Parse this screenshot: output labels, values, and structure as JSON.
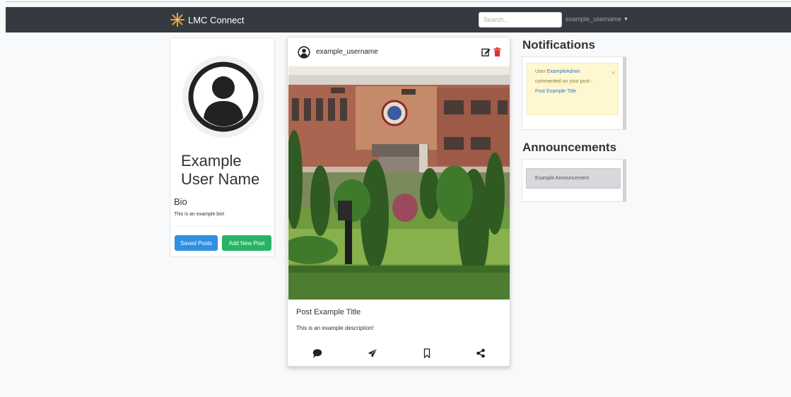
{
  "app": {
    "brand_name": "LMC Connect",
    "brand_color": "#e8a33a"
  },
  "header": {
    "search_placeholder": "Search...",
    "username": "example_username",
    "caret": "▼",
    "bg_color": "#343a40"
  },
  "profile": {
    "name": "Example User Name",
    "bio_label": "Bio",
    "bio_text": "This is an example bio!",
    "saved_posts_label": "Saved Posts",
    "add_post_label": "Add New Post",
    "saved_color": "#2f8fe0",
    "add_color": "#28b463"
  },
  "post": {
    "username": "example_username",
    "title": "Post Example Title",
    "description_plain": "This is an ",
    "description_emph": "example description!",
    "actions": [
      "comment-icon",
      "send-icon",
      "bookmark-icon",
      "share-icon"
    ],
    "delete_color": "#e03131"
  },
  "notifications": {
    "title": "Notifications",
    "items": [
      {
        "prefix": "User ",
        "actor": "ExampleAdmin",
        "middle": " commented on your post - ",
        "post_link": "Post Example Title",
        "close": "×"
      }
    ]
  },
  "announcements": {
    "title": "Announcements",
    "items": [
      {
        "text": "Example Announcement"
      }
    ]
  }
}
